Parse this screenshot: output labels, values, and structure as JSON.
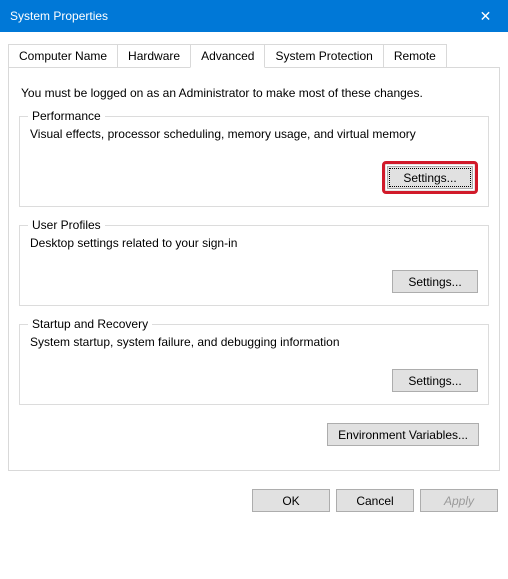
{
  "title": "System Properties",
  "tabs": {
    "computerName": "Computer Name",
    "hardware": "Hardware",
    "advanced": "Advanced",
    "systemProtection": "System Protection",
    "remote": "Remote"
  },
  "intro": "You must be logged on as an Administrator to make most of these changes.",
  "performance": {
    "legend": "Performance",
    "desc": "Visual effects, processor scheduling, memory usage, and virtual memory",
    "button": "Settings..."
  },
  "userProfiles": {
    "legend": "User Profiles",
    "desc": "Desktop settings related to your sign-in",
    "button": "Settings..."
  },
  "startup": {
    "legend": "Startup and Recovery",
    "desc": "System startup, system failure, and debugging information",
    "button": "Settings..."
  },
  "envVars": "Environment Variables...",
  "footer": {
    "ok": "OK",
    "cancel": "Cancel",
    "apply": "Apply"
  }
}
